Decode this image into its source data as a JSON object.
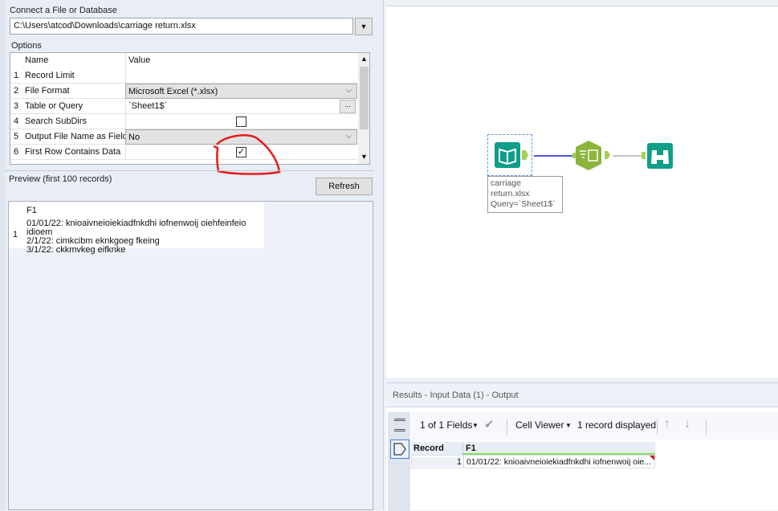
{
  "config": {
    "connect_label": "Connect a File or Database",
    "file_path": "C:\\Users\\atcod\\Downloads\\carriage return.xlsx",
    "options_label": "Options",
    "grid_headers": {
      "name": "Name",
      "value": "Value"
    },
    "options": [
      {
        "num": "1",
        "name": "Record Limit",
        "value": ""
      },
      {
        "num": "2",
        "name": "File Format",
        "value": "Microsoft Excel (*.xlsx)"
      },
      {
        "num": "3",
        "name": "Table or Query",
        "value": "`Sheet1$`",
        "button": "..."
      },
      {
        "num": "4",
        "name": "Search SubDirs",
        "checked": false
      },
      {
        "num": "5",
        "name": "Output File Name as Field",
        "value": "No"
      },
      {
        "num": "6",
        "name": "First Row Contains Data",
        "checked": true
      }
    ],
    "preview_label": "Preview (first 100 records)",
    "refresh_label": "Refresh",
    "preview": {
      "header": "F1",
      "row_num": "1",
      "lines": [
        "01/01/22: knioaivneioiekiadfnkdhi iofnenwoij oiehfeinfeio idioem",
        "2/1/22: cimkcibm eknkgoeg fkeing",
        "3/1/22: ckkmvkeg eifknke"
      ]
    }
  },
  "canvas": {
    "tools": [
      {
        "name": "Input Data",
        "icon": "book-icon"
      },
      {
        "name": "Select",
        "icon": "select-table-icon"
      },
      {
        "name": "Browse",
        "icon": "binoculars-icon"
      }
    ],
    "annotation": [
      "carriage",
      "return.xlsx",
      "Query=`Sheet1$`"
    ],
    "colors": {
      "input": "#0e9e89",
      "select": "#8cb43c",
      "browse": "#0e9e89",
      "connection": "#1a1adf"
    }
  },
  "results": {
    "title": "Results - Input Data (1) - Output",
    "fields": "1 of 1 Fields",
    "viewer": "Cell Viewer",
    "count": "1 record displayed",
    "headers": [
      "Record",
      "F1"
    ],
    "rows": [
      {
        "record": "1",
        "f1": "01/01/22: knioaivneioiekiadfnkdhi iofnenwoij oie..."
      }
    ]
  }
}
